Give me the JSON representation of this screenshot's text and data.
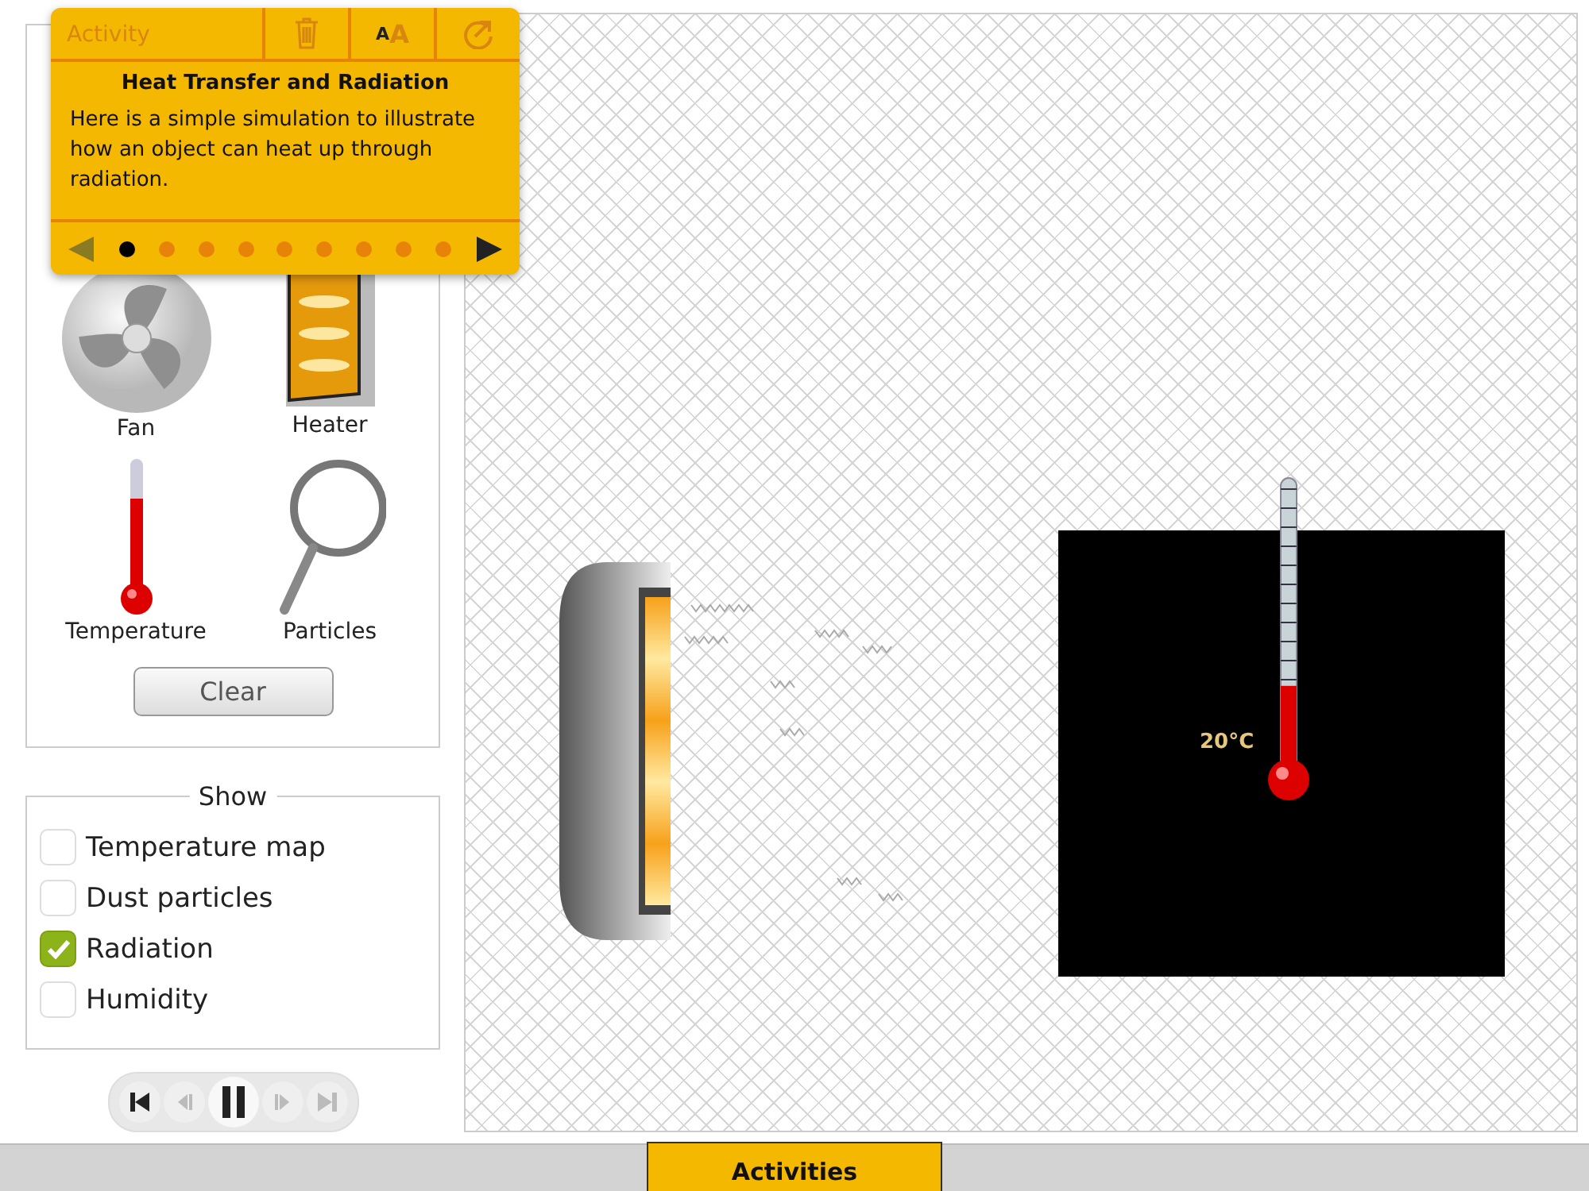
{
  "activity_panel": {
    "header": "Activity",
    "font_button": "AA",
    "title": "Heat Transfer and Radiation",
    "text": "Here is a simple simulation to illustrate how an object can heat up through radiation.",
    "prev_disabled": true,
    "next_disabled": false,
    "pages": [
      {
        "selected": true
      },
      {
        "selected": false
      },
      {
        "selected": false
      },
      {
        "selected": false
      },
      {
        "selected": false
      },
      {
        "selected": false
      },
      {
        "selected": false
      },
      {
        "selected": false
      },
      {
        "selected": false
      }
    ]
  },
  "tools": [
    {
      "kind": "fan",
      "label": "Fan"
    },
    {
      "kind": "heater",
      "label": "Heater"
    },
    {
      "kind": "thermometer",
      "label": "Temperature"
    },
    {
      "kind": "magnifier",
      "label": "Particles"
    }
  ],
  "clear_button": "Clear",
  "show": {
    "title": "Show",
    "options": [
      {
        "label": "Temperature map",
        "checked": false
      },
      {
        "label": "Dust particles",
        "checked": false
      },
      {
        "label": "Radiation",
        "checked": true
      },
      {
        "label": "Humidity",
        "checked": false
      }
    ]
  },
  "playback": [
    {
      "kind": "start",
      "disabled": false
    },
    {
      "kind": "step-back",
      "disabled": true
    },
    {
      "kind": "pause",
      "disabled": false
    },
    {
      "kind": "step-forward",
      "disabled": true
    },
    {
      "kind": "end",
      "disabled": true
    }
  ],
  "canvas": {
    "thermometer": {
      "reading": "20°C",
      "level": 0.3
    }
  },
  "bottom_tabs": [
    {
      "label": "Activities",
      "selected": true
    }
  ]
}
